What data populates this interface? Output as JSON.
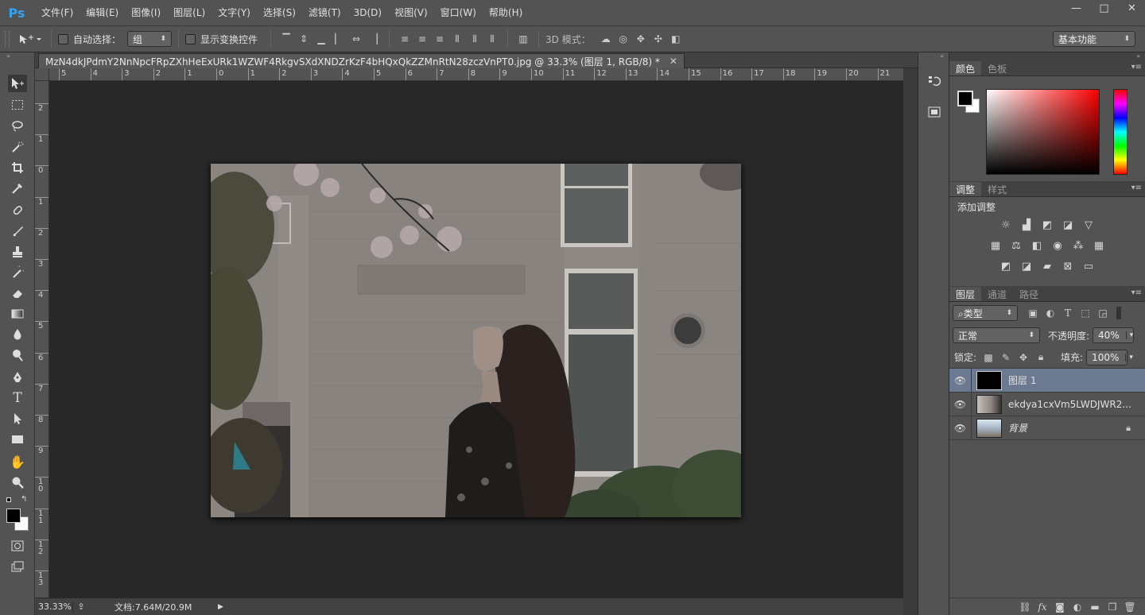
{
  "app": {
    "logo": "Ps"
  },
  "menu": [
    "文件(F)",
    "编辑(E)",
    "图像(I)",
    "图层(L)",
    "文字(Y)",
    "选择(S)",
    "滤镜(T)",
    "3D(D)",
    "视图(V)",
    "窗口(W)",
    "帮助(H)"
  ],
  "window_controls": {
    "minimize": "—",
    "restore": "□",
    "close": "✕"
  },
  "options": {
    "auto_select_label": "自动选择：",
    "auto_select_value": "组",
    "show_transform_label": "显示变换控件",
    "mode3d_label": "3D 模式：",
    "workspace": "基本功能"
  },
  "document": {
    "tab_title": "MzN4dkJPdmY2NnNpcFRpZXhHeExURk1WZWF4RkgvSXdXNDZrKzF4bHQxQkZZMnRtN28zczVnPT0.jpg @ 33.3% (图层 1, RGB/8) *",
    "close": "✕"
  },
  "ruler_top": [
    "5",
    "4",
    "3",
    "2",
    "1",
    "0",
    "1",
    "2",
    "3",
    "4",
    "5",
    "6",
    "7",
    "8",
    "9",
    "10",
    "11",
    "12",
    "13",
    "14",
    "15",
    "16",
    "17",
    "18",
    "19",
    "20",
    "21"
  ],
  "ruler_left": [
    "2",
    "1",
    "0",
    "1",
    "2",
    "3",
    "4",
    "5",
    "6",
    "7",
    "8",
    "9",
    "1\n0",
    "1\n1",
    "1\n2",
    "1\n3"
  ],
  "status": {
    "zoom": "33.33%",
    "doc_size": "文档:7.64M/20.9M"
  },
  "color_panel": {
    "tabs": [
      "颜色",
      "色板"
    ]
  },
  "adjust_panel": {
    "tabs": [
      "调整",
      "样式"
    ],
    "title": "添加调整"
  },
  "layers_panel": {
    "tabs": [
      "图层",
      "通道",
      "路径"
    ],
    "filter_kind": "类型",
    "blend_mode": "正常",
    "opacity_label": "不透明度:",
    "opacity_value": "40%",
    "lock_label": "锁定:",
    "fill_label": "填充:",
    "fill_value": "100%",
    "layers": [
      {
        "name": "图层 1",
        "selected": true
      },
      {
        "name": "ekdya1cxVm5LWDJWR2...",
        "selected": false
      },
      {
        "name": "背景",
        "selected": false,
        "locked": true
      }
    ]
  },
  "colors": {
    "accent_blue": "#2fa3f5",
    "selection": "#6b7a91"
  }
}
